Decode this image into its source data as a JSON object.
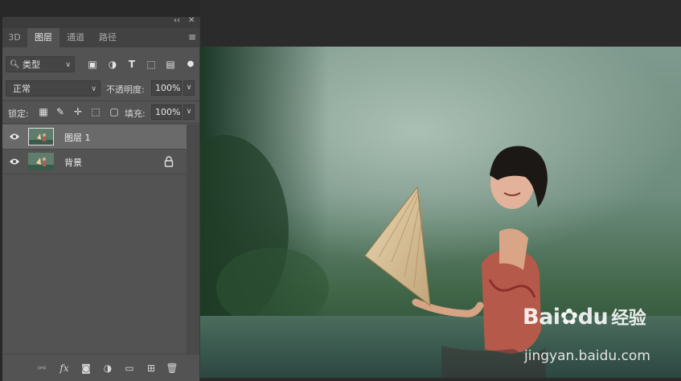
{
  "panel": {
    "tabs": [
      {
        "label": "3D"
      },
      {
        "label": "图层"
      },
      {
        "label": "通道"
      },
      {
        "label": "路径"
      }
    ],
    "active_tab": "图层",
    "filter": {
      "label": "类型"
    },
    "blend_mode": {
      "value": "正常"
    },
    "opacity": {
      "label": "不透明度:",
      "value": "100%"
    },
    "lock": {
      "label": "锁定:"
    },
    "fill": {
      "label": "填充:",
      "value": "100%"
    },
    "layers": [
      {
        "name": "图层 1",
        "selected": true,
        "locked": false
      },
      {
        "name": "背景",
        "selected": false,
        "locked": true
      }
    ]
  },
  "watermark": {
    "brand": "Bai",
    "brand_suffix": "du",
    "brand_cn": "经验",
    "url": "jingyan.baidu.com"
  },
  "colors": {
    "panel_bg": "#535353",
    "selected_layer": "#6a6a6a",
    "workspace": "#282828"
  }
}
